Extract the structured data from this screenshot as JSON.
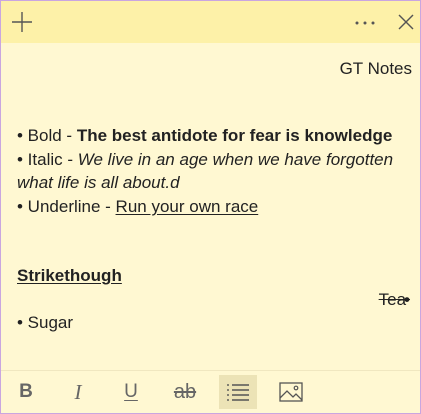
{
  "window": {
    "toolbar_title": "GT Notes"
  },
  "titlebar": {
    "new_icon": "plus-icon",
    "menu_icon": "more-icon",
    "close_icon": "close-icon"
  },
  "note": {
    "bold_prefix": "• Bold - ",
    "bold_text": "The best antidote for fear is knowledge",
    "italic_prefix": "• Italic - ",
    "italic_text_1": "We live in an age when we have forgotten",
    "italic_text_2": "what life is all about.d",
    "underline_prefix": "• Underline - ",
    "underline_text": "Run your own race",
    "strike_heading": "Strikethough",
    "strike_item": "Tea",
    "strike_dot": "•",
    "bullet_item": "• Sugar"
  },
  "format_toolbar": {
    "bold_label": "B",
    "italic_label": "I",
    "underline_label": "U",
    "strike_label": "ab",
    "list_icon": "bullet-list-icon",
    "image_icon": "image-icon"
  },
  "colors": {
    "note_background": "#fff8d2",
    "titlebar_background": "#fdf1a8",
    "active_button": "#ece3b6",
    "border": "#c9a6e0"
  }
}
